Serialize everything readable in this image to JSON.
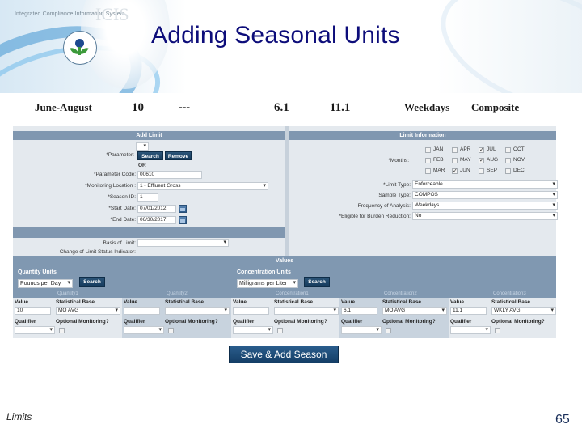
{
  "banner": {
    "brand_text": "Integrated Compliance Information System",
    "brand_logo_word": "ICIS",
    "seal_icon": "epa-seal-icon"
  },
  "slide_title": "Adding Seasonal Units",
  "summary": {
    "period": "June-August",
    "quantity1": "10",
    "quantity2": "---",
    "concentration1": "6.1",
    "concentration2": "11.1",
    "frequency": "Weekdays",
    "sample_type": "Composite"
  },
  "add_limit": {
    "header": "Add Limit",
    "parameter_label": "*Parameter:",
    "parameter_value": "",
    "search_label": "Search",
    "remove_label": "Remove",
    "or_label": "OR",
    "parameter_code_label": "*Parameter Code:",
    "parameter_code_value": "00610",
    "monitoring_location_label": "*Monitoring Location :",
    "monitoring_location_value": "1 - Effluent Gross",
    "season_id_label": "*Season ID:",
    "season_id_value": "1",
    "start_date_label": "*Start Date:",
    "start_date_value": "07/01/2012",
    "end_date_label": "*End Date:",
    "end_date_value": "06/30/2017",
    "basis_label": "Basis of Limit:",
    "basis_value": "",
    "change_status_label": "Change of Limit Status Indicator:"
  },
  "limit_info": {
    "header": "Limit Information",
    "months_label": "*Months:",
    "months": [
      {
        "label": "JAN",
        "checked": false
      },
      {
        "label": "APR",
        "checked": false
      },
      {
        "label": "JUL",
        "checked": true
      },
      {
        "label": "OCT",
        "checked": false
      },
      {
        "label": "FEB",
        "checked": false
      },
      {
        "label": "MAY",
        "checked": false
      },
      {
        "label": "AUG",
        "checked": true
      },
      {
        "label": "NOV",
        "checked": false
      },
      {
        "label": "MAR",
        "checked": false
      },
      {
        "label": "JUN",
        "checked": true
      },
      {
        "label": "SEP",
        "checked": false
      },
      {
        "label": "DEC",
        "checked": false
      }
    ],
    "limit_type_label": "*Limit Type:",
    "limit_type_value": "Enforceable",
    "sample_type_label": "Sample Type:",
    "sample_type_value": "COMPOS",
    "frequency_label": "Frequency of Analysis:",
    "frequency_value": "Weekdays",
    "burden_label": "*Eligible for Burden Reduction:",
    "burden_value": "No"
  },
  "values": {
    "header": "Values",
    "quantity_units_label": "Quantity Units",
    "quantity_units_value": "Pounds per Day",
    "concentration_units_label": "Concentration Units",
    "concentration_units_value": "Milligrams per Liter",
    "search_label": "Search",
    "col_labels": {
      "value": "Value",
      "stat_base": "Statistical Base",
      "qualifier": "Qualifier",
      "optional": "Optional Monitoring?"
    },
    "groups": [
      {
        "name": "Quantity1",
        "value": "10",
        "stat_base": "MO AVG",
        "qualifier": "",
        "optional": false
      },
      {
        "name": "Quantity2",
        "value": "",
        "stat_base": "",
        "qualifier": "",
        "optional": false
      },
      {
        "name": "Concentration1",
        "value": "",
        "stat_base": "",
        "qualifier": "",
        "optional": false
      },
      {
        "name": "Concentration2",
        "value": "6.1",
        "stat_base": "MO AVG",
        "qualifier": "",
        "optional": false
      },
      {
        "name": "Concentration3",
        "value": "11.1",
        "stat_base": "WKLY AVG",
        "qualifier": "",
        "optional": false
      }
    ]
  },
  "save_button_label": "Save & Add Season",
  "footer": {
    "section": "Limits",
    "page_number": "65"
  }
}
